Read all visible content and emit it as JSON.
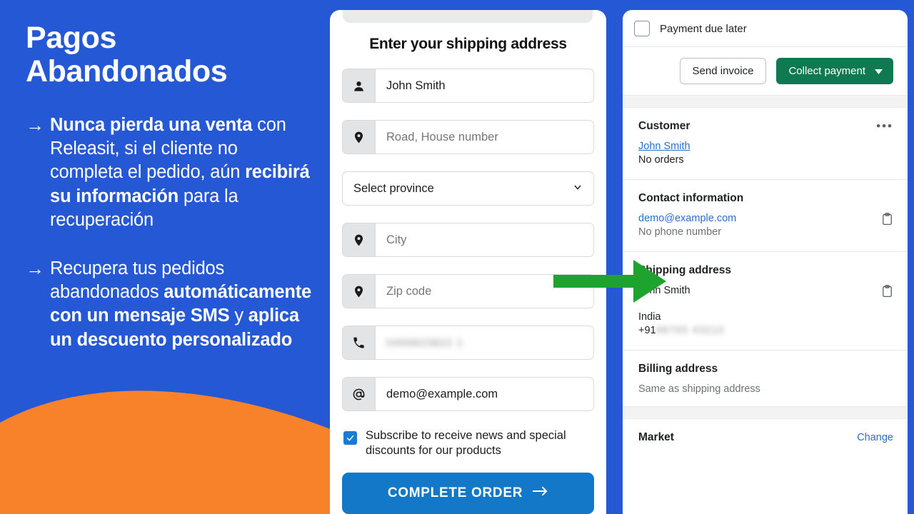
{
  "promo": {
    "title": "Pagos\nAbandonados",
    "arrow_glyph": "→",
    "bullets": [
      {
        "id": "bullet-1",
        "segments": [
          {
            "text": "Nunca pierda una venta ",
            "bold": true
          },
          {
            "text": "con Releasit, si el cliente no completa el pedido, aún ",
            "bold": false
          },
          {
            "text": "recibirá su información ",
            "bold": true
          },
          {
            "text": "para la recuperación",
            "bold": false
          }
        ]
      },
      {
        "id": "bullet-2",
        "segments": [
          {
            "text": "Recupera tus pedidos abandonados ",
            "bold": false
          },
          {
            "text": "automáticamente con un mensaje SMS ",
            "bold": true
          },
          {
            "text": "y ",
            "bold": false
          },
          {
            "text": "aplica un descuento personalizado",
            "bold": true
          }
        ]
      }
    ],
    "colors": {
      "background": "#2558d4",
      "wave": "#f7822a",
      "text": "#ffffff"
    }
  },
  "checkout": {
    "heading": "Enter your shipping address",
    "fields": [
      {
        "icon": "person-icon",
        "value": "John Smith",
        "state": "filled"
      },
      {
        "icon": "location-icon",
        "value": "Road, House number",
        "state": "placeholder"
      },
      {
        "icon": "location-icon",
        "value": "City",
        "state": "placeholder"
      },
      {
        "icon": "location-icon",
        "value": "Zip code",
        "state": "placeholder"
      },
      {
        "icon": "phone-icon",
        "value": "0499823822 1",
        "state": "redacted"
      },
      {
        "icon": "at-icon",
        "value": "demo@example.com",
        "state": "filled"
      }
    ],
    "province_select": {
      "value": "Select province",
      "icon": "chevron-down-icon"
    },
    "subscribe": {
      "label": "Subscribe to receive news and special discounts for our products",
      "checked": true
    },
    "submit": {
      "label": "COMPLETE ORDER",
      "icon": "arrow-right-icon",
      "color": "#1478c8"
    }
  },
  "admin": {
    "payment_due": {
      "label": "Payment due later",
      "checked": false
    },
    "actions": {
      "send_invoice": "Send invoice",
      "collect_payment": "Collect payment",
      "collect_payment_icon": "caret-down-icon",
      "collect_payment_color": "#0f7a52"
    },
    "customer": {
      "title": "Customer",
      "more_icon": "ellipsis-icon",
      "name": "John Smith",
      "orders": "No orders"
    },
    "contact": {
      "title": "Contact information",
      "email": "demo@example.com",
      "phone": "No phone number",
      "copy_icon": "clipboard-copy-icon"
    },
    "shipping": {
      "title": "Shipping address",
      "name": "John Smith",
      "country": "India",
      "phone_prefix": "+91",
      "phone_redacted": "98765 43210",
      "copy_icon": "clipboard-copy-icon"
    },
    "billing": {
      "title": "Billing address",
      "value": "Same as shipping address"
    },
    "market": {
      "title": "Market",
      "change_label": "Change"
    }
  },
  "overlay": {
    "arrow": {
      "icon": "green-arrow-right",
      "color": "#1fa32f"
    }
  }
}
